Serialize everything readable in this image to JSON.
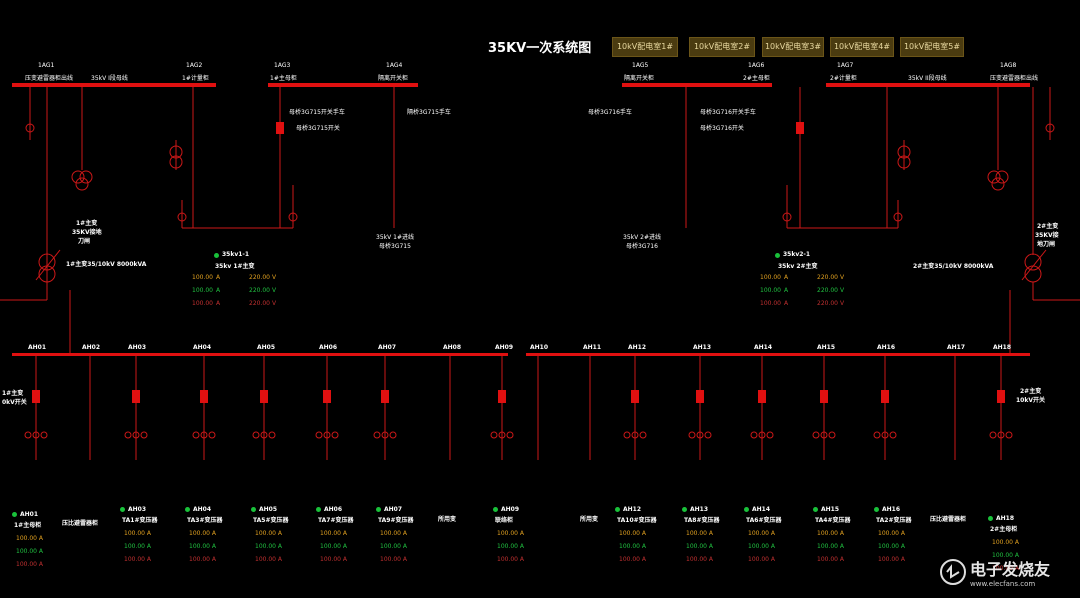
{
  "title": "35KV一次系统图",
  "rooms": [
    "10kV配电室1#",
    "10kV配电室2#",
    "10kV配电室3#",
    "10kV配电室4#",
    "10kV配电室5#"
  ],
  "ag": [
    {
      "id": "1AG1",
      "name": "压变避雷器柜出线"
    },
    {
      "id": "1AG2",
      "name": "1#计量柜"
    },
    {
      "id": "1AG3",
      "name": "1#主母柜"
    },
    {
      "id": "1AG4",
      "name": "隔离开关柜"
    },
    {
      "id": "1AG5",
      "name": "隔离开关柜"
    },
    {
      "id": "1AG6",
      "name": "2#主母柜"
    },
    {
      "id": "1AG7",
      "name": "2#计量柜"
    },
    {
      "id": "1AG8",
      "name": "压变避雷器柜出线"
    }
  ],
  "bus_left": "35kV I段母线",
  "bus_right": "35kV II段母线",
  "labels": {
    "l_sw_1": "母桥3G715开关手车",
    "l_sw_2": "母桥3G715开关",
    "l_sw_3": "隔桥3G715手车",
    "r_sw_1": "母桥3G716手车",
    "r_sw_2": "母桥3G716开关手车",
    "r_sw_3": "母桥3G716开关",
    "l_line_1": "35kV 1#进线",
    "l_line_2": "母桥3G715",
    "r_line_1": "35kV 2#进线",
    "r_line_2": "母桥3G716",
    "l_tr_knife_1": "1#主变",
    "l_tr_knife_2": "35KV接地",
    "l_tr_knife_3": "刀闸",
    "l_tr": "1#主变35/10kV 8000kVA",
    "r_tr_knife_1": "2#主变",
    "r_tr_knife_2": "35KV接",
    "r_tr_knife_3": "地刀闸",
    "r_tr": "2#主变35/10kV 8000kVA",
    "l_10kv_1": "1#主变",
    "l_10kv_2": "0kV开关",
    "r_10kv_1": "2#主变",
    "r_10kv_2": "10kV开关"
  },
  "meters": [
    {
      "id": "35kv1-1",
      "name": "35kv 1#主变",
      "rows": [
        [
          "100.00",
          "A",
          "220.00",
          "V"
        ],
        [
          "100.00",
          "A",
          "220.00",
          "V"
        ],
        [
          "100.00",
          "A",
          "220.00",
          "V"
        ]
      ]
    },
    {
      "id": "35kv2-1",
      "name": "35kv 2#主变",
      "rows": [
        [
          "100.00",
          "A",
          "220.00",
          "V"
        ],
        [
          "100.00",
          "A",
          "220.00",
          "V"
        ],
        [
          "100.00",
          "A",
          "220.00",
          "V"
        ]
      ]
    }
  ],
  "ah_heads": [
    "AH01",
    "AH02",
    "AH03",
    "AH04",
    "AH05",
    "AH06",
    "AH07",
    "AH08",
    "AH09",
    "AH10",
    "AH11",
    "AH12",
    "AH13",
    "AH14",
    "AH15",
    "AH16",
    "AH17",
    "AH18"
  ],
  "feeders": [
    {
      "id": "AH01",
      "name": "1#主母柜"
    },
    {
      "id": "",
      "name": "压比避雷器柜"
    },
    {
      "id": "AH03",
      "name": "TA1#变压器"
    },
    {
      "id": "AH04",
      "name": "TA3#变压器"
    },
    {
      "id": "AH05",
      "name": "TA5#变压器"
    },
    {
      "id": "AH06",
      "name": "TA7#变压器"
    },
    {
      "id": "AH07",
      "name": "TA9#变压器"
    },
    {
      "id": "",
      "name": "所用变"
    },
    {
      "id": "AH09",
      "name": "联络柜"
    },
    {
      "id": "",
      "name": "所用变"
    },
    {
      "id": "AH12",
      "name": "TA10#变压器"
    },
    {
      "id": "AH13",
      "name": "TA8#变压器"
    },
    {
      "id": "AH14",
      "name": "TA6#变压器"
    },
    {
      "id": "AH15",
      "name": "TA4#变压器"
    },
    {
      "id": "AH16",
      "name": "TA2#变压器"
    },
    {
      "id": "",
      "name": "压比避雷器柜"
    },
    {
      "id": "AH18",
      "name": "2#主母柜"
    }
  ],
  "reading": {
    "value": "100.00",
    "unit": "A"
  },
  "watermark": {
    "text": "电子发烧友",
    "sub": "www.elecfans.com"
  },
  "colors": {
    "bus": "#e01010",
    "line": "#cc1818",
    "amber": "#e0a020",
    "green": "#20c040",
    "red": "#c03030",
    "room": "#4a3b10"
  }
}
